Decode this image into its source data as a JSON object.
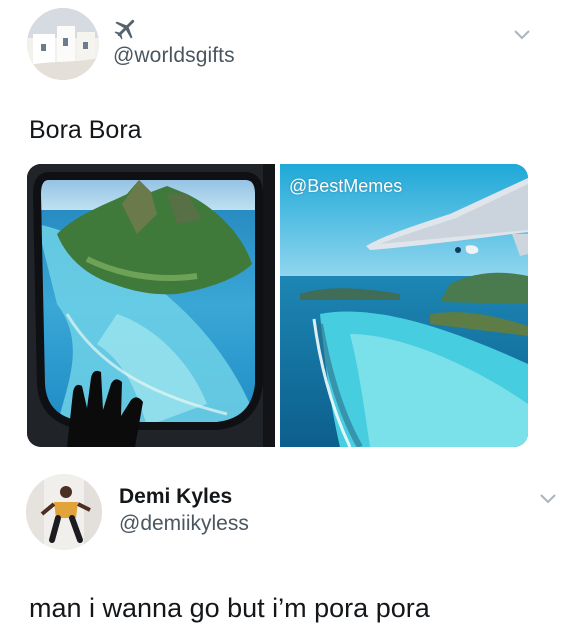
{
  "tweet1": {
    "handle": "@worldsgifts",
    "text": "Bora Bora",
    "images": {
      "left_label": "",
      "right_watermark": "@BestMemes"
    }
  },
  "tweet2": {
    "name": "Demi Kyles",
    "handle": "@demiikyless",
    "text": "man i wanna go but i’m pora pora"
  },
  "colors": {
    "text_primary": "#14171a",
    "text_secondary": "#4b5660",
    "background": "#ffffff",
    "chevron": "#aab4be"
  },
  "icons": [
    "airplane-icon",
    "chevron-down-icon"
  ]
}
